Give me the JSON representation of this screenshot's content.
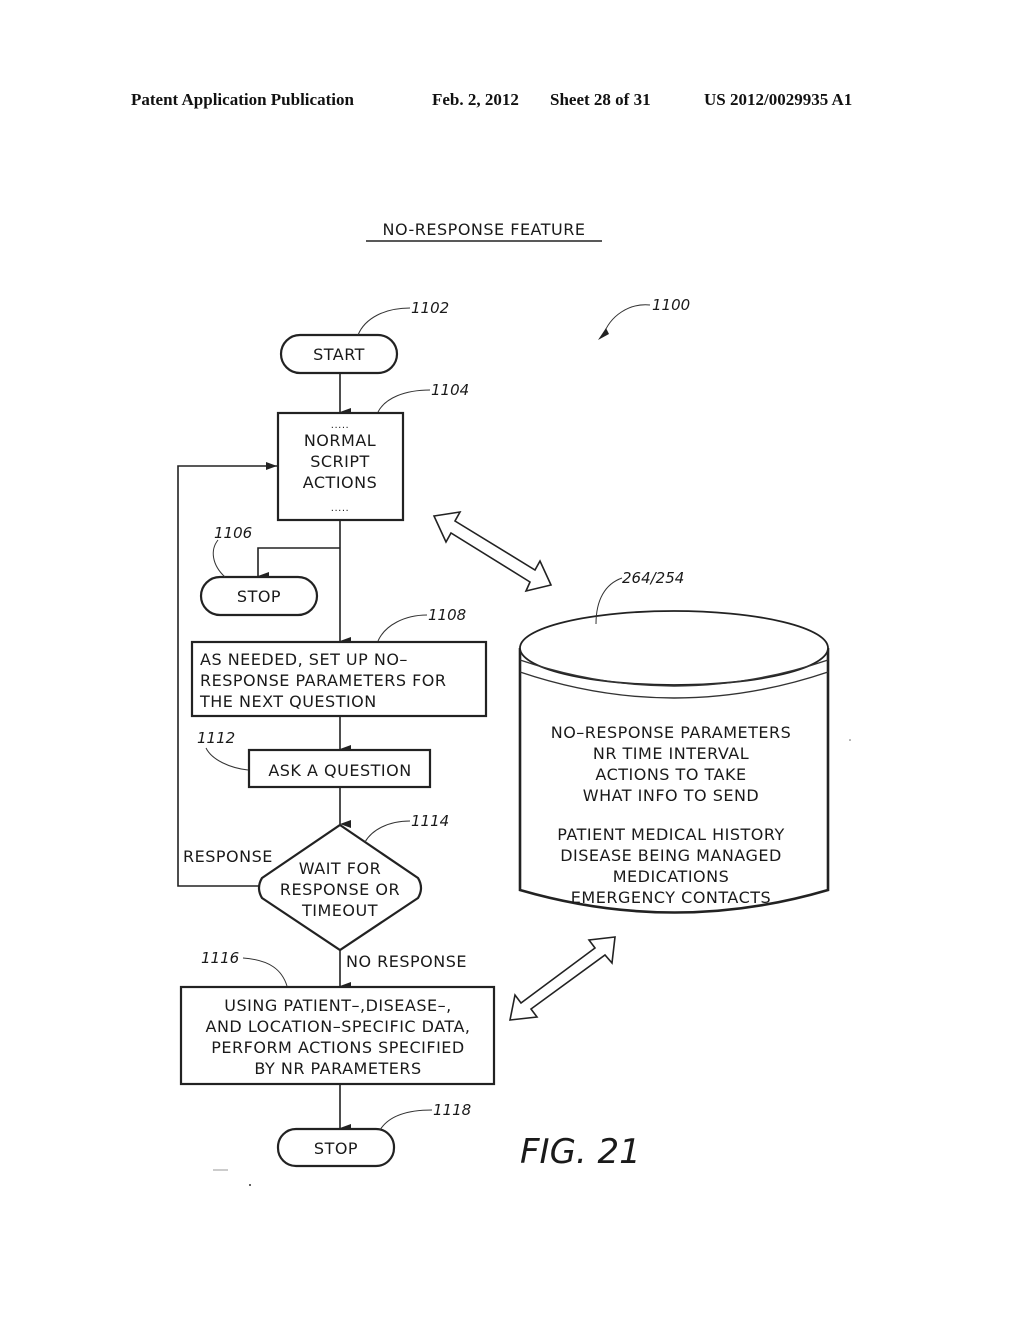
{
  "header": {
    "publication": "Patent Application Publication",
    "date": "Feb. 2, 2012",
    "sheet": "Sheet 28 of 31",
    "number": "US 2012/0029935 A1"
  },
  "diagram": {
    "title": "NO-RESPONSE FEATURE",
    "figure_ref": "1100",
    "figure_label": "FIG. 21",
    "nodes": {
      "start": {
        "ref": "1102",
        "label": "START"
      },
      "normal": {
        "ref": "1104",
        "dots": ".....",
        "lines": [
          "NORMAL",
          "SCRIPT",
          "ACTIONS"
        ]
      },
      "stop1": {
        "ref": "1106",
        "label": "STOP"
      },
      "setup": {
        "ref": "1108",
        "lines": [
          "AS NEEDED, SET UP NO–",
          "RESPONSE PARAMETERS FOR",
          "THE NEXT QUESTION"
        ]
      },
      "ask": {
        "ref": "1112",
        "label": "ASK A QUESTION"
      },
      "wait": {
        "ref": "1114",
        "lines": [
          "WAIT FOR",
          "RESPONSE OR",
          "TIMEOUT"
        ]
      },
      "perform": {
        "ref": "1116",
        "lines": [
          "USING PATIENT–,DISEASE–,",
          "AND LOCATION–SPECIFIC DATA,",
          "PERFORM ACTIONS SPECIFIED",
          "BY NR PARAMETERS"
        ]
      },
      "stop2": {
        "ref": "1118",
        "label": "STOP"
      },
      "database": {
        "ref": "264/254",
        "lines": [
          "NO–RESPONSE PARAMETERS",
          "NR TIME INTERVAL",
          "ACTIONS TO TAKE",
          "WHAT INFO TO SEND"
        ],
        "lines2": [
          "PATIENT MEDICAL HISTORY",
          "DISEASE BEING MANAGED",
          "MEDICATIONS",
          "EMERGENCY CONTACTS"
        ]
      }
    },
    "edge_labels": {
      "response": "RESPONSE",
      "no_response": "NO RESPONSE"
    }
  }
}
